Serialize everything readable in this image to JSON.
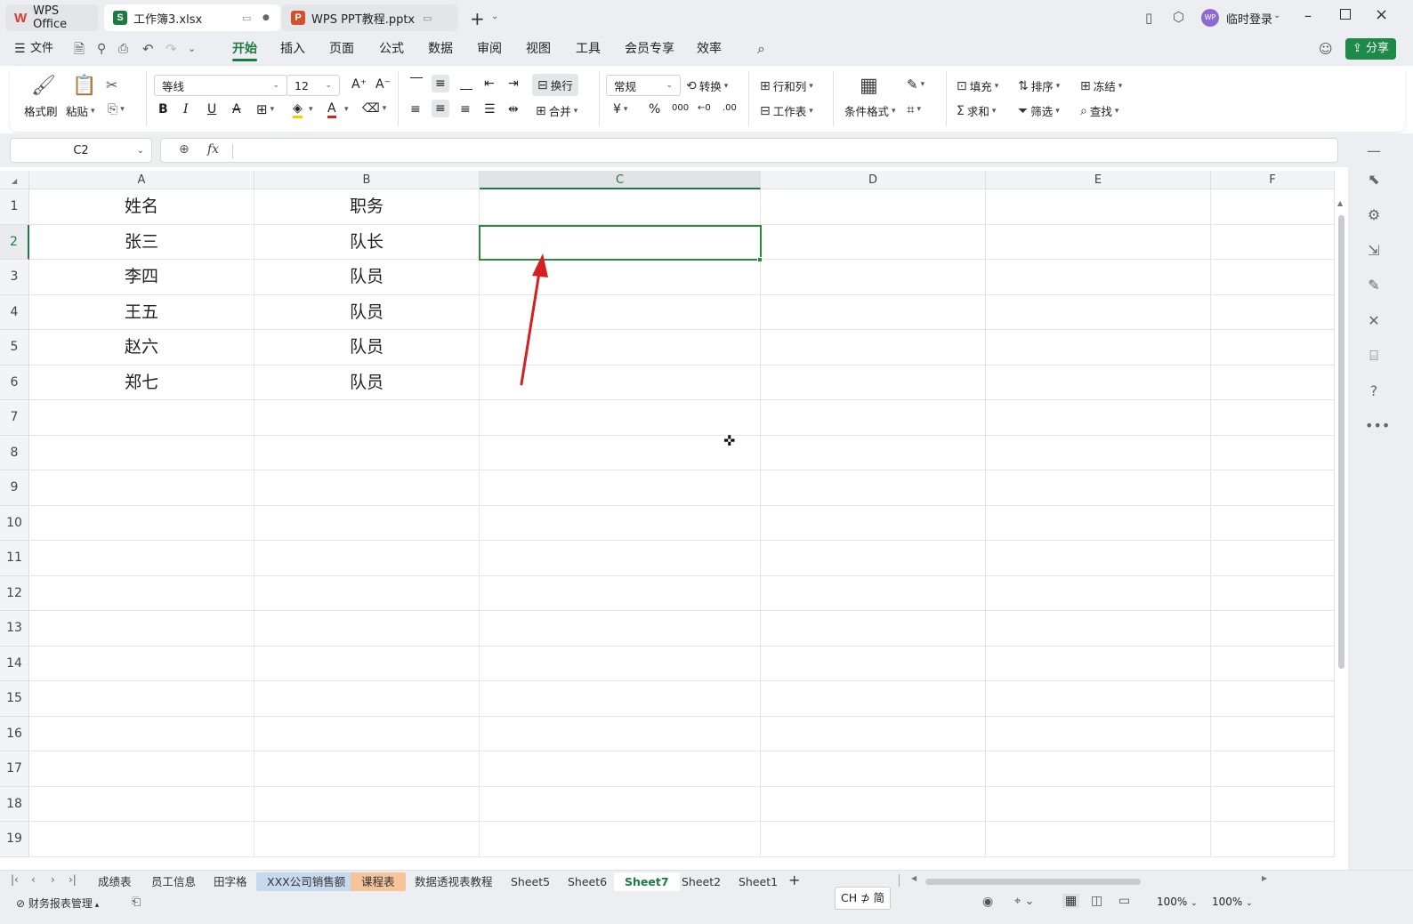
{
  "tabs": [
    {
      "label": "WPS Office",
      "logo": "W",
      "color": "#d63b2c"
    },
    {
      "label": "工作簿3.xlsx",
      "logo": "S",
      "color": "#1d7a43"
    },
    {
      "label": "WPS PPT教程.pptx",
      "logo": "P",
      "color": "#d3502a"
    }
  ],
  "user": {
    "avatar": "WP",
    "login": "临时登录"
  },
  "menu": {
    "file": "文件",
    "items": [
      "开始",
      "插入",
      "页面",
      "公式",
      "数据",
      "审阅",
      "视图",
      "工具",
      "会员专享",
      "效率"
    ],
    "active": "开始",
    "share": "分享"
  },
  "ribbon": {
    "format_painter": "格式刷",
    "paste": "粘贴",
    "font_name": "等线",
    "font_size": "12",
    "wrap": "换行",
    "merge": "合并",
    "number_format": "常规",
    "convert": "转换",
    "row_col": "行和列",
    "worksheet": "工作表",
    "cond_format": "条件格式",
    "fill": "填充",
    "sort": "排序",
    "freeze": "冻结",
    "sum": "求和",
    "filter": "筛选",
    "find": "查找",
    "currency_icon": "¥",
    "percent_icon": "%",
    "thousands_icon": "000",
    "dec_inc": "←0",
    "dec_dec": ".00"
  },
  "formula": {
    "cell_ref": "C2",
    "fx": "fx",
    "value": ""
  },
  "columns": [
    "A",
    "B",
    "C",
    "D",
    "E",
    "F"
  ],
  "selected_col": "C",
  "selected_row": "2",
  "rows": [
    "1",
    "2",
    "3",
    "4",
    "5",
    "6",
    "7",
    "8",
    "9",
    "10",
    "11",
    "12",
    "13",
    "14",
    "15",
    "16",
    "17",
    "18",
    "19"
  ],
  "cells": [
    {
      "a": "姓名",
      "b": "职务"
    },
    {
      "a": "张三",
      "b": "队长"
    },
    {
      "a": "李四",
      "b": "队员"
    },
    {
      "a": "王五",
      "b": "队员"
    },
    {
      "a": "赵六",
      "b": "队员"
    },
    {
      "a": "郑七",
      "b": "队员"
    }
  ],
  "sheets": [
    {
      "name": "成绩表",
      "bg": ""
    },
    {
      "name": "员工信息",
      "bg": ""
    },
    {
      "name": "田字格",
      "bg": ""
    },
    {
      "name": "XXX公司销售额",
      "bg": "#c6d9ef"
    },
    {
      "name": "课程表",
      "bg": "#f6c49b"
    },
    {
      "name": "数据透视表教程",
      "bg": ""
    },
    {
      "name": "Sheet5",
      "bg": ""
    },
    {
      "name": "Sheet6",
      "bg": ""
    },
    {
      "name": "Sheet7",
      "bg": "",
      "active": true
    },
    {
      "name": "Sheet2",
      "bg": ""
    },
    {
      "name": "Sheet1",
      "bg": ""
    }
  ],
  "status": {
    "left": "财务报表管理",
    "ime": "CH ⊅ 简",
    "zoom1": "100%",
    "zoom2": "100%"
  },
  "colors": {
    "accent": "#1d7a43",
    "arrow": "#d42020"
  }
}
